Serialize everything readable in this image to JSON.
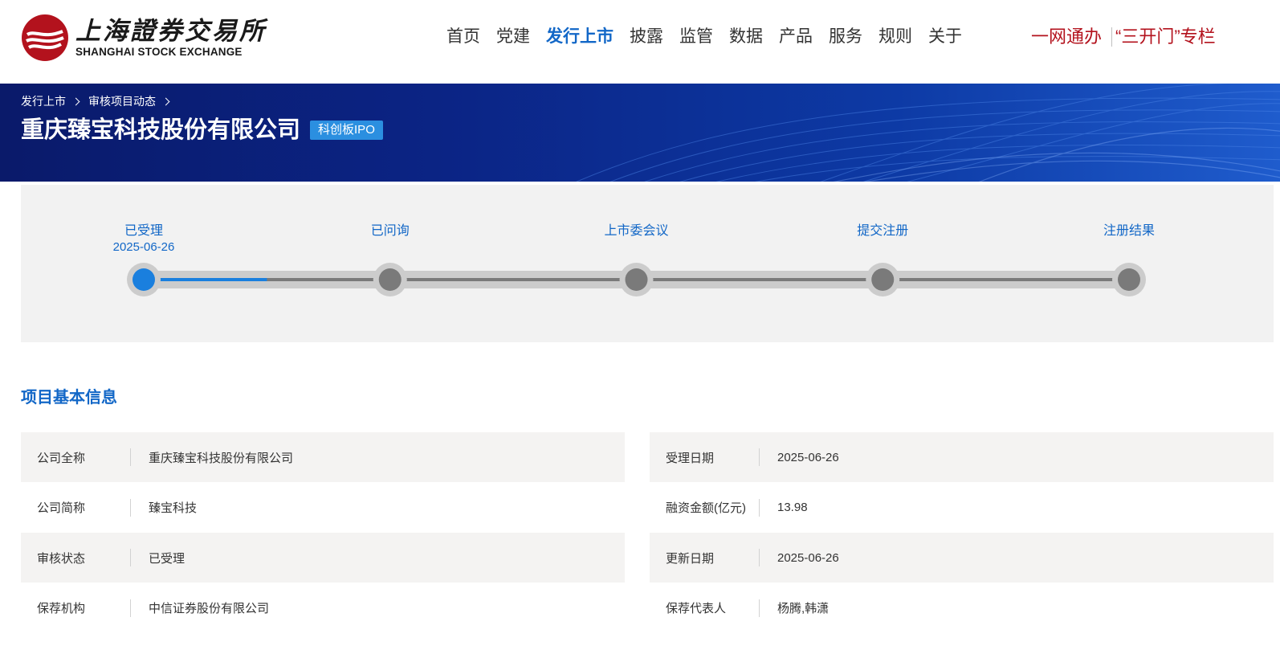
{
  "header": {
    "logo_cn": "上海證券交易所",
    "logo_en": "SHANGHAI STOCK EXCHANGE",
    "nav": [
      {
        "label": "首页",
        "active": false
      },
      {
        "label": "党建",
        "active": false
      },
      {
        "label": "发行上市",
        "active": true
      },
      {
        "label": "披露",
        "active": false
      },
      {
        "label": "监管",
        "active": false
      },
      {
        "label": "数据",
        "active": false
      },
      {
        "label": "产品",
        "active": false
      },
      {
        "label": "服务",
        "active": false
      },
      {
        "label": "规则",
        "active": false
      },
      {
        "label": "关于",
        "active": false
      }
    ],
    "special_links": [
      "一网通办",
      "“三开门”专栏"
    ],
    "colors": {
      "brand_red": "#b3121d",
      "accent_blue": "#1267c7"
    }
  },
  "banner": {
    "breadcrumb": [
      "发行上市",
      "审核项目动态"
    ],
    "company_title": "重庆臻宝科技股份有限公司",
    "board_badge": "科创板IPO"
  },
  "progress": {
    "steps": [
      {
        "label": "已受理",
        "date": "2025-06-26",
        "done": true
      },
      {
        "label": "已问询",
        "date": "",
        "done": false
      },
      {
        "label": "上市委会议",
        "date": "",
        "done": false
      },
      {
        "label": "提交注册",
        "date": "",
        "done": false
      },
      {
        "label": "注册结果",
        "date": "",
        "done": false
      }
    ],
    "fill_fraction": 0.125,
    "colors": {
      "active": "#1a7fde",
      "inactive": "#7a7a7a",
      "track": "#cccccc"
    }
  },
  "section": {
    "title": "项目基本信息"
  },
  "info": {
    "rows": [
      {
        "left_label": "公司全称",
        "left_value": "重庆臻宝科技股份有限公司",
        "right_label": "受理日期",
        "right_value": "2025-06-26"
      },
      {
        "left_label": "公司简称",
        "left_value": "臻宝科技",
        "right_label": "融资金额(亿元)",
        "right_value": "13.98"
      },
      {
        "left_label": "审核状态",
        "left_value": "已受理",
        "right_label": "更新日期",
        "right_value": "2025-06-26"
      },
      {
        "left_label": "保荐机构",
        "left_value": "中信证券股份有限公司",
        "right_label": "保荐代表人",
        "right_value": "杨腾,韩潇"
      }
    ]
  }
}
